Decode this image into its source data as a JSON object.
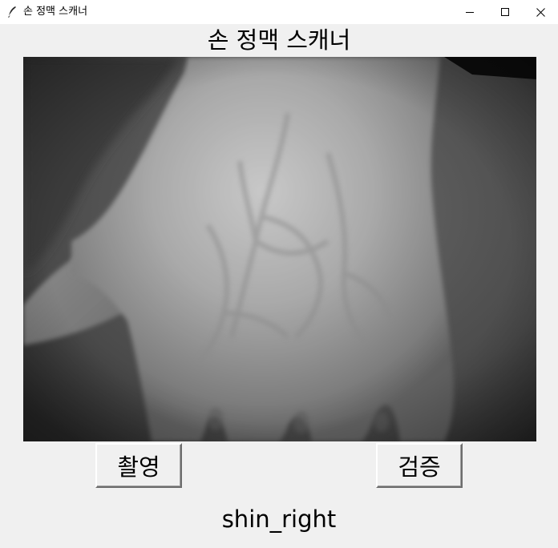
{
  "window": {
    "title": "손 정맥 스캐너",
    "controls": {
      "minimize_icon": "minimize-icon",
      "maximize_icon": "maximize-icon",
      "close_icon": "close-icon"
    },
    "app_icon": "feather-icon"
  },
  "header": {
    "title": "손 정맥 스캐너"
  },
  "camera": {
    "content": "grayscale infrared image of the back of a right hand showing veins"
  },
  "buttons": {
    "capture_label": "촬영",
    "verify_label": "검증"
  },
  "status": {
    "result": "shin_right"
  },
  "colors": {
    "window_bg": "#f0f0f0",
    "titlebar_bg": "#ffffff"
  }
}
